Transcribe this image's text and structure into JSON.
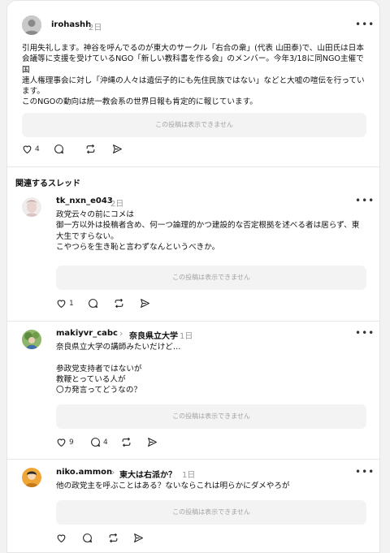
{
  "post": {
    "username": "irohashh",
    "time": "2日",
    "text": "引用失礼します。神谷を呼んでるのが東大のサークル「右合の衆」(代表 山田泰)で、山田氏は日本\n会議等に支援を受けているNGO「新しい教科書を作る会」のメンバー。今年3/18に同NGO主催で国\n連人権理事会に対し「沖縄の人々は遺伝子的にも先住民族ではない」などと大嘘の喧伝を行ってい\nます。\nこのNGOの動向は統一教会系の世界日報も肯定的に報じています。",
    "hidden_notice": "この投稿は表示できません",
    "like_count": "4"
  },
  "related": {
    "title": "関連するスレッド",
    "threads": [
      {
        "username": "tk_nxn_e043",
        "tag": "",
        "time": "2日",
        "text": "政党云々の前にコメは\n御一方以外は投稿者含め、何一つ論理的かつ建設的な否定根拠を述べる者は居らず、東\n大生ですらない。\nこやつらを生き恥と言わずなんというべきか。",
        "hidden_notice": "この投稿は表示できません",
        "like_count": "1",
        "reply_count": ""
      },
      {
        "username": "makiyvr_cabc",
        "tag": "奈良県立大学",
        "time": "1日",
        "text": "奈良県立大学の講師みたいだけど…\n\n参政党支持者ではないが\n教鞭とっている人が\n〇カ発言ってどうなの？",
        "hidden_notice": "この投稿は表示できません",
        "like_count": "9",
        "reply_count": "4"
      },
      {
        "username": "niko.ammon",
        "tag": "東大は右派か？",
        "time": "1日",
        "text": "他の政党主を呼ぶことはある？ないならこれは明らかにダメやろが",
        "hidden_notice": "この投稿は表示できません",
        "like_count": "",
        "reply_count": ""
      }
    ]
  },
  "colors": {
    "text": "#111111",
    "muted": "#999999",
    "hidden_box": "#f3f3f3",
    "divider": "#e8e8e8"
  },
  "icons": [
    "heart-icon",
    "comment-icon",
    "repost-icon",
    "send-icon",
    "more-icon",
    "chevron-right-icon"
  ]
}
